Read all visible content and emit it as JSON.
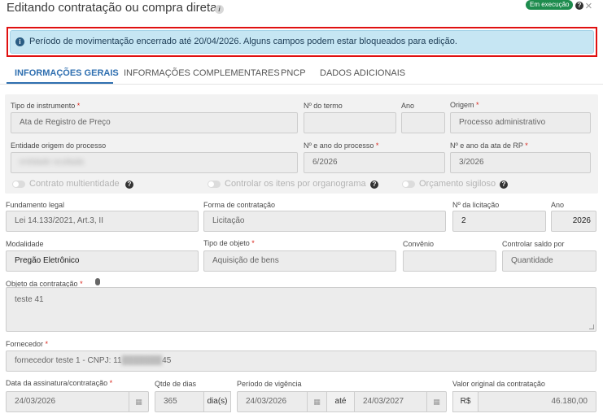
{
  "header": {
    "title": "Editando contratação ou compra direta",
    "status_badge": "Em execução",
    "help_icon": "?",
    "close_icon": "×"
  },
  "alert": {
    "text": "Período de movimentação encerrado até 20/04/2026. Alguns campos podem estar bloqueados para edição.",
    "icon": "info-icon"
  },
  "tabs": [
    {
      "label": "INFORMAÇÕES GERAIS",
      "active": true
    },
    {
      "label": "INFORMAÇÕES COMPLEMENTARES",
      "active": false
    },
    {
      "label": "PNCP",
      "active": false
    },
    {
      "label": "DADOS ADICIONAIS",
      "active": false
    }
  ],
  "panel": {
    "tipo_instrumento": {
      "label": "Tipo de instrumento",
      "value": "Ata de Registro de Preço"
    },
    "numero_termo": {
      "label": "Nº do termo",
      "value": ""
    },
    "ano": {
      "label": "Ano",
      "value": ""
    },
    "origem": {
      "label": "Origem",
      "value": "Processo administrativo"
    },
    "entidade_origem": {
      "label": "Entidade origem do processo",
      "value": "entidade ocultada"
    },
    "numero_ano_processo": {
      "label": "Nº e ano do processo",
      "value": "6/2026"
    },
    "numero_ano_ata": {
      "label": "Nº e ano da ata de RP",
      "value": "3/2026"
    },
    "toggles": [
      {
        "label": "Contrato multientidade"
      },
      {
        "label": "Controlar os itens por organograma"
      },
      {
        "label": "Orçamento sigiloso"
      }
    ]
  },
  "form": {
    "fundamento_legal": {
      "label": "Fundamento legal",
      "value": "Lei 14.133/2021, Art.3, II"
    },
    "forma_contratacao": {
      "label": "Forma de contratação",
      "value": "Licitação"
    },
    "numero_licitacao": {
      "label": "Nº da licitação",
      "value": "2"
    },
    "ano_licitacao": {
      "label": "Ano",
      "value": "2026"
    },
    "modalidade": {
      "label": "Modalidade",
      "value": "Pregão Eletrônico"
    },
    "tipo_objeto": {
      "label": "Tipo de objeto",
      "value": "Aquisição de bens"
    },
    "convenio": {
      "label": "Convênio",
      "value": ""
    },
    "controlar_saldo": {
      "label": "Controlar saldo por",
      "value": "Quantidade"
    },
    "objeto": {
      "label": "Objeto da contratação",
      "value": "teste 41"
    },
    "fornecedor": {
      "label": "Fornecedor",
      "value_start": "fornecedor teste 1 - CNPJ: 11",
      "value_masked": "███████",
      "value_end": "45"
    },
    "data_assinatura": {
      "label": "Data da assinatura/contratação",
      "value": "24/03/2026"
    },
    "qtde_dias": {
      "label": "Qtde de dias",
      "value": "365",
      "suffix": "dia(s)"
    },
    "periodo_vigencia": {
      "label": "Período de vigência",
      "start": "24/03/2026",
      "separator": "até",
      "end": "24/03/2027"
    },
    "valor_original": {
      "label": "Valor original da contratação",
      "currency": "R$",
      "value": "46.180,00"
    }
  },
  "colors": {
    "accent": "#2f6fb0",
    "badge": "#1e8c4e",
    "alert_bg": "#c6e6f3",
    "alert_border_highlight": "#e01010",
    "required": "#d9261c"
  }
}
